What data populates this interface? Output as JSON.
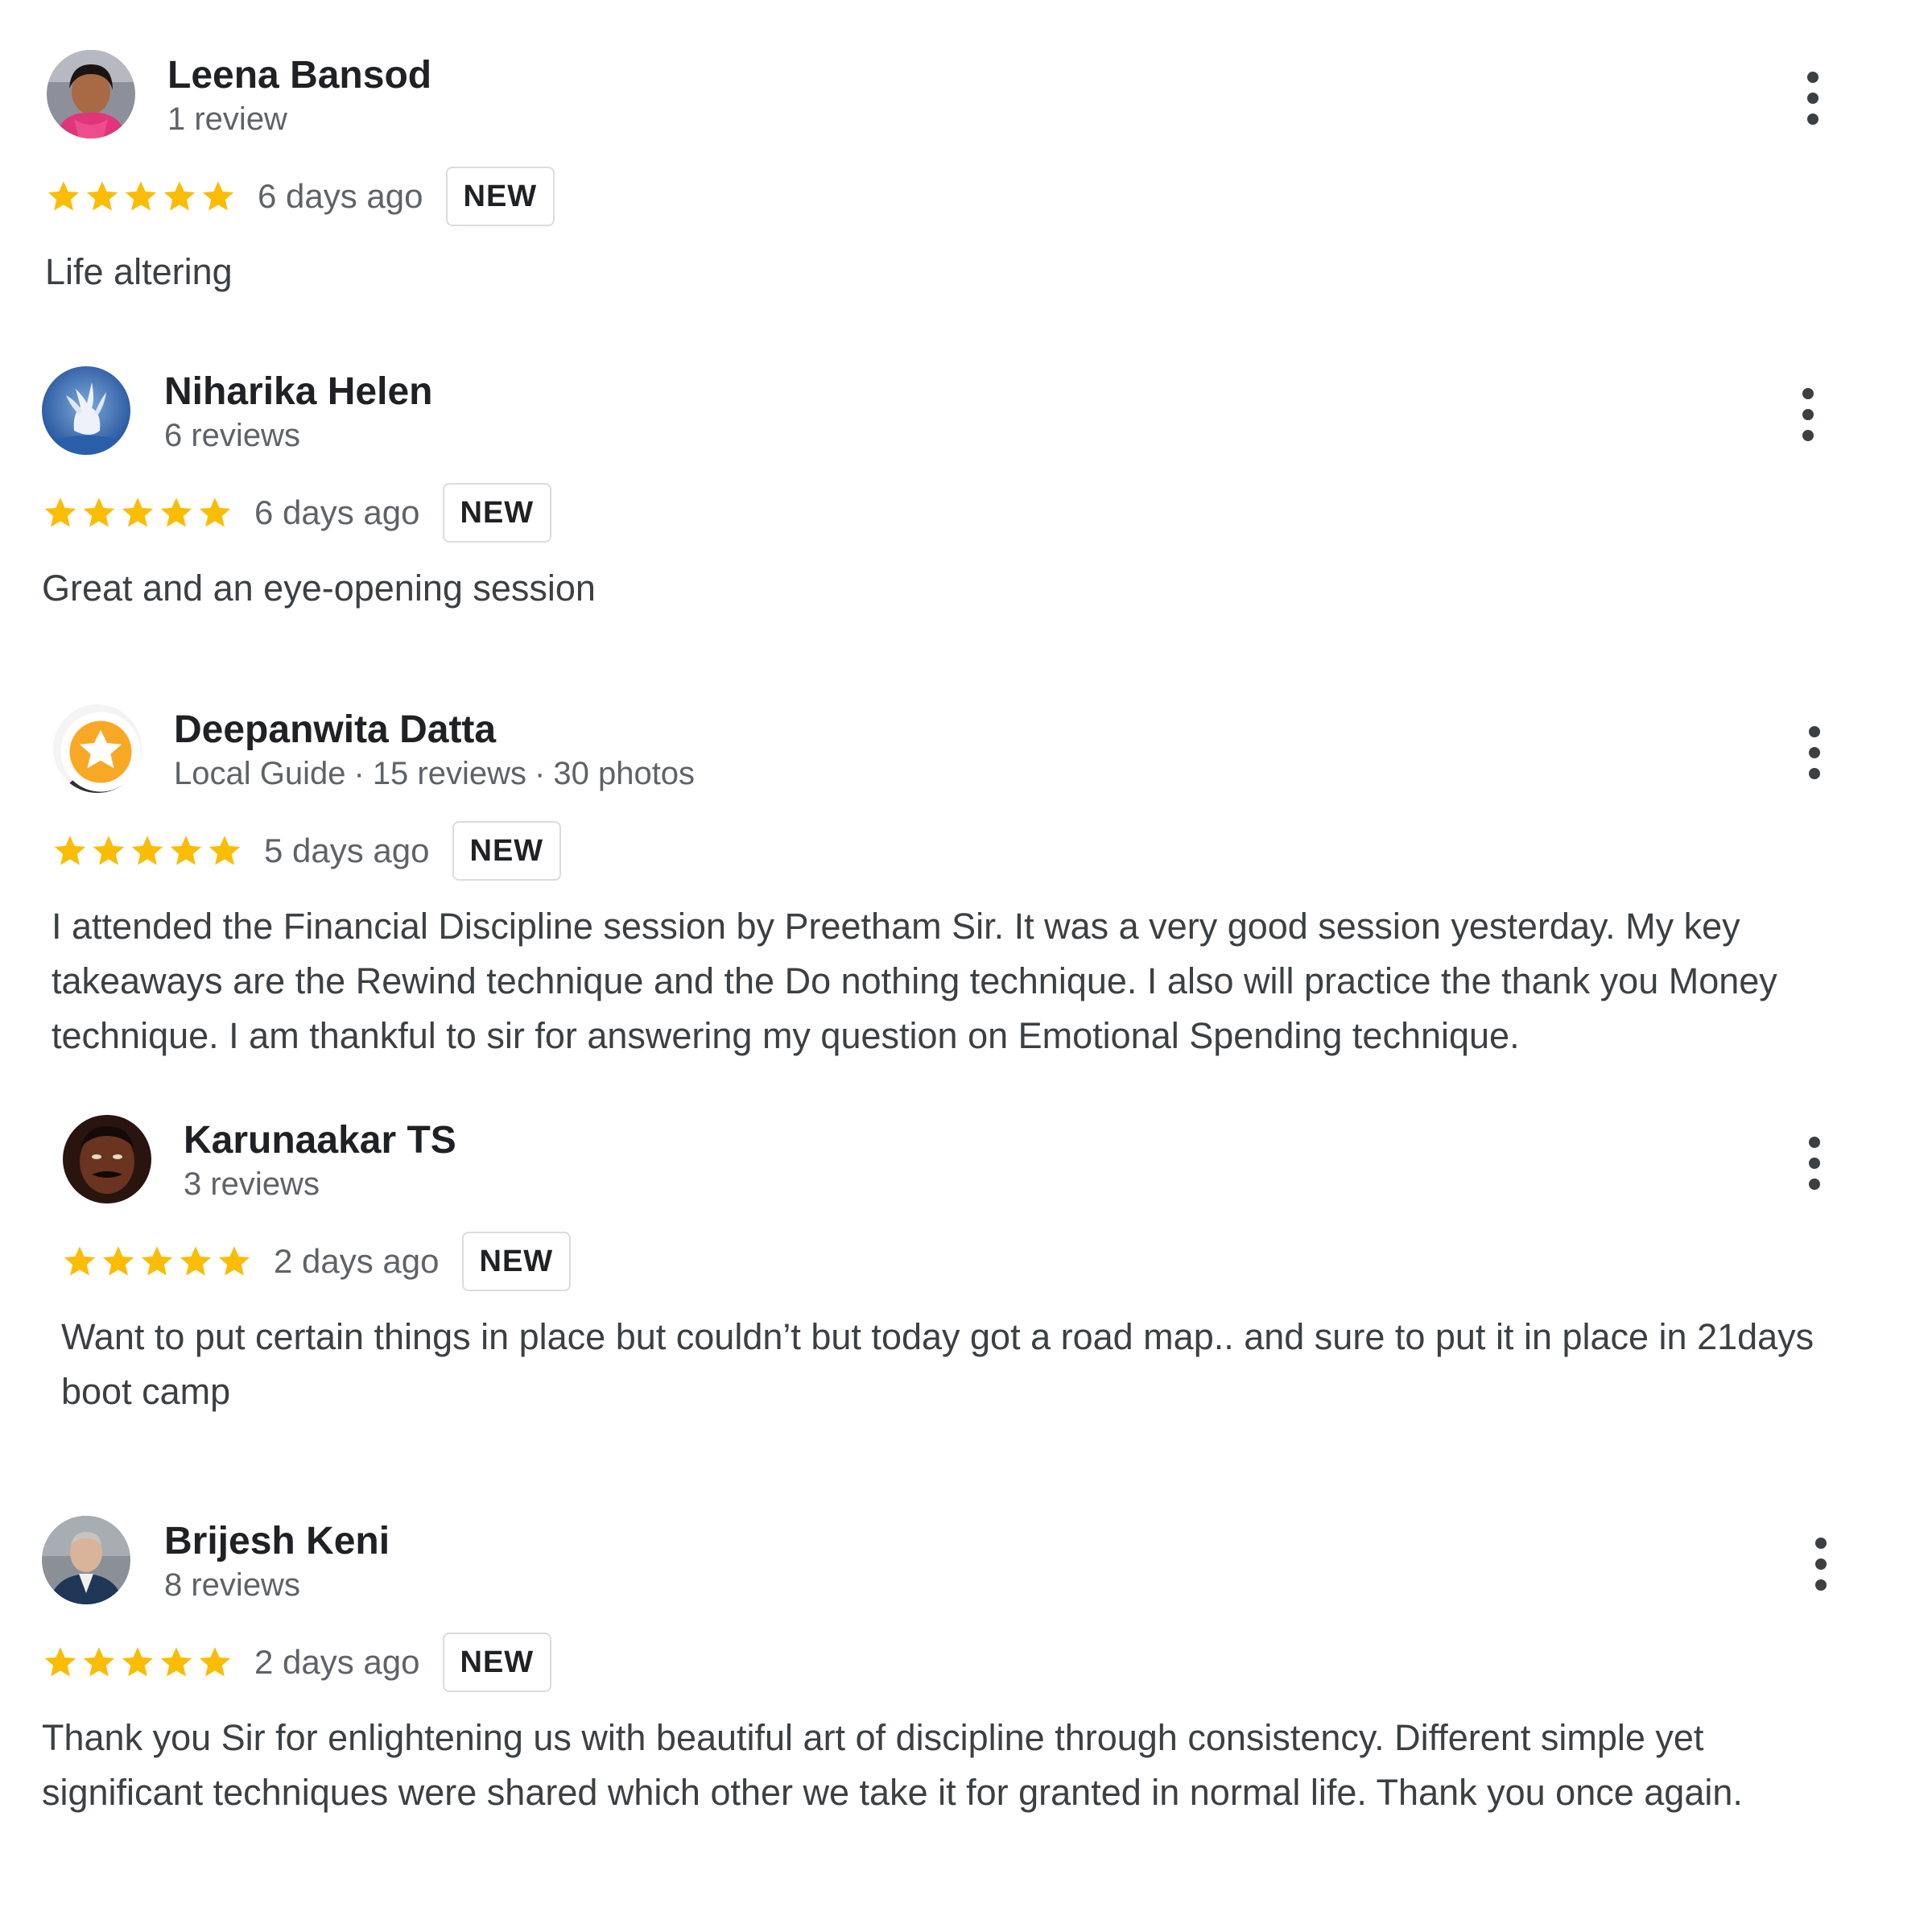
{
  "colors": {
    "star": "#FBBC04",
    "name": "#202124",
    "meta": "#5f6368",
    "text": "#3c4043",
    "badge_border": "#dadce0"
  },
  "reviews": [
    {
      "name": "Leena Bansod",
      "meta": "1 review",
      "rating": 5,
      "date": "6 days ago",
      "badge": "NEW",
      "text": "Life altering",
      "avatar": "user-photo-avatar"
    },
    {
      "name": "Niharika Helen",
      "meta": "6 reviews",
      "rating": 5,
      "date": "6 days ago",
      "badge": "NEW",
      "text": "Great and an eye-opening session",
      "avatar": "pegasus-avatar"
    },
    {
      "name": "Deepanwita Datta",
      "meta": "Local Guide",
      "meta_reviews": "15 reviews",
      "meta_photos": "30 photos",
      "meta_sep": "·",
      "rating": 5,
      "date": "5 days ago",
      "badge": "NEW",
      "text": "I attended the Financial Discipline session by Preetham Sir. It was a very good session yesterday. My key takeaways are the Rewind technique and the Do nothing technique. I also will practice the thank you Money technique. I am thankful to sir for answering my question on Emotional Spending technique.",
      "avatar": "user-photo-avatar",
      "local_guide_badge": "local-guide-star-icon"
    },
    {
      "name": "Karunaakar TS",
      "meta": "3 reviews",
      "rating": 5,
      "date": "2 days ago",
      "badge": "NEW",
      "text": "Want to put certain things in place but couldn’t but today got a road map.. and sure to put it in place in 21days boot camp",
      "avatar": "user-photo-avatar"
    },
    {
      "name": "Brijesh Keni",
      "meta": "8 reviews",
      "rating": 5,
      "date": "2 days ago",
      "badge": "NEW",
      "text": "Thank you Sir for enlightening us with beautiful art of discipline through consistency. Different simple yet significant techniques were shared which other we take it for granted in normal life. Thank you once again.",
      "avatar": "user-photo-avatar"
    }
  ]
}
